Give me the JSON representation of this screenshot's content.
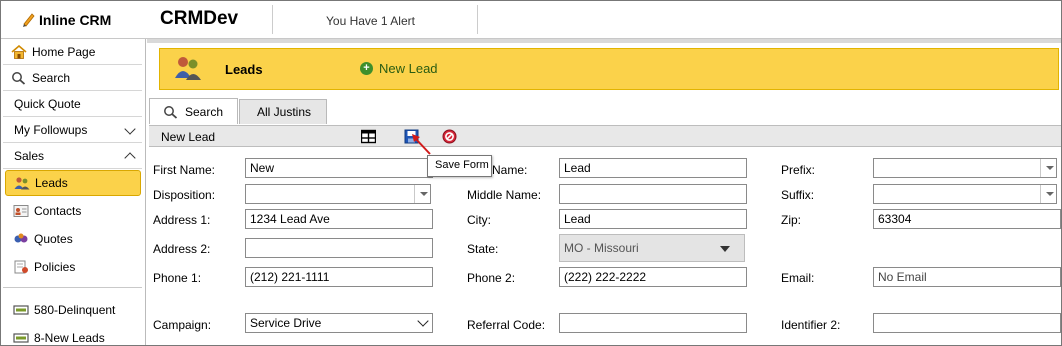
{
  "app": {
    "brand": "Inline CRM",
    "title": "CRMDev",
    "alert": "You Have 1 Alert"
  },
  "sidebar": {
    "items": [
      {
        "label": "Home Page",
        "icon": "home-icon"
      },
      {
        "label": "Search",
        "icon": "search-icon"
      },
      {
        "label": "Quick Quote"
      },
      {
        "label": "My Followups",
        "icon": "chevron-down-icon"
      },
      {
        "label": "Sales",
        "icon": "chevron-up-icon"
      }
    ],
    "sales_items": [
      {
        "label": "Leads",
        "icon": "leads-icon",
        "active": true
      },
      {
        "label": "Contacts",
        "icon": "contacts-icon"
      },
      {
        "label": "Quotes",
        "icon": "quotes-icon"
      },
      {
        "label": "Policies",
        "icon": "policies-icon"
      }
    ],
    "lists": [
      {
        "label": "580-Delinquent",
        "icon": "list-icon"
      },
      {
        "label": "8-New Leads",
        "icon": "list-icon"
      }
    ]
  },
  "banner": {
    "title": "Leads",
    "new_label": "New Lead"
  },
  "tabs": [
    {
      "label": "Search",
      "icon": "search-icon"
    },
    {
      "label": "All Justins"
    }
  ],
  "toolbar": {
    "title": "New Lead",
    "tooltip": "Save Form",
    "icons": [
      "grid-icon",
      "save-icon",
      "cancel-icon"
    ]
  },
  "form": {
    "first_name": {
      "label": "First Name:",
      "value": "New"
    },
    "last_name": {
      "label": "Last Name:",
      "visible_label": "Name:",
      "value": "Lead"
    },
    "prefix": {
      "label": "Prefix:",
      "value": ""
    },
    "disposition": {
      "label": "Disposition:",
      "value": ""
    },
    "middle_name": {
      "label": "Middle Name:",
      "value": ""
    },
    "suffix": {
      "label": "Suffix:",
      "value": ""
    },
    "address1": {
      "label": "Address 1:",
      "value": "1234 Lead Ave"
    },
    "city": {
      "label": "City:",
      "value": "Lead"
    },
    "zip": {
      "label": "Zip:",
      "value": "63304"
    },
    "address2": {
      "label": "Address 2:",
      "value": ""
    },
    "state": {
      "label": "State:",
      "value": "MO - Missouri"
    },
    "phone1": {
      "label": "Phone 1:",
      "value": "(212) 221-1111"
    },
    "phone2": {
      "label": "Phone 2:",
      "value": "(222) 222-2222"
    },
    "email": {
      "label": "Email:",
      "value": "No Email"
    },
    "campaign": {
      "label": "Campaign:",
      "value": "Service Drive"
    },
    "referral_code": {
      "label": "Referral Code:",
      "value": ""
    },
    "identifier2": {
      "label": "Identifier 2:",
      "value": ""
    }
  },
  "colors": {
    "accent": "#fbd24a",
    "accent_border": "#d9a700",
    "toolbar_bg": "#e8e8e8"
  }
}
